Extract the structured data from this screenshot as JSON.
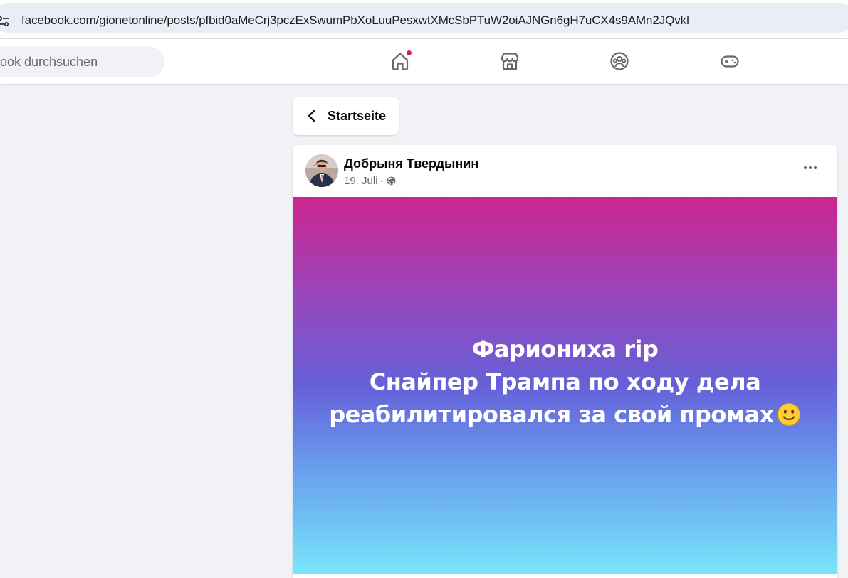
{
  "browser": {
    "url": "facebook.com/gionetonline/posts/pfbid0aMeCrj3pczExSwumPbXoLuuPesxwtXMcSbPTuW2oiAJNGn6gH7uCX4s9AMn2JQvkl",
    "site_info_icon": "tune-icon"
  },
  "topbar": {
    "search_text": "ook durchsuchen",
    "nav": [
      {
        "name": "home-icon",
        "notification": true
      },
      {
        "name": "marketplace-icon"
      },
      {
        "name": "groups-icon"
      },
      {
        "name": "gaming-icon"
      }
    ],
    "notification_color": "#e41e3f"
  },
  "back": {
    "label": "Startseite",
    "icon": "chevron-left-icon"
  },
  "post": {
    "author": "Добрыня Твердынин",
    "date": "19. Juli",
    "separator": "·",
    "privacy_icon": "globe-icon",
    "more_icon": "more-horizontal-icon",
    "text_lines": [
      "Фариониха rip",
      "Снайпер Трампа по ходу дела",
      "реабилитировался за свой промах"
    ],
    "emoji": "slightly-smiling-face-icon",
    "gradient": [
      "#cc2590",
      "#6660d8",
      "#78e6fa"
    ]
  }
}
